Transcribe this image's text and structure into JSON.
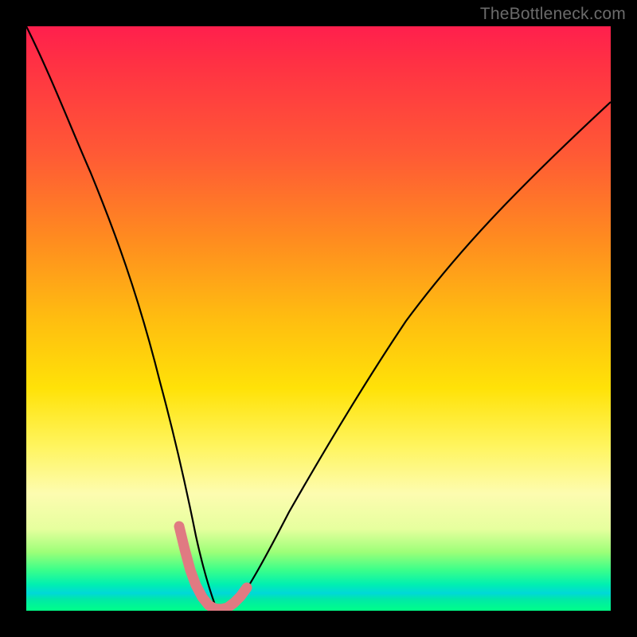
{
  "watermark": {
    "text": "TheBottleneck.com"
  },
  "colors": {
    "background": "#000000",
    "curve": "#000000",
    "marker_stroke": "#e07a82",
    "gradient_stops": [
      "#ff1f4d",
      "#ff5a35",
      "#ffbd10",
      "#fff560",
      "#9cff78",
      "#00d8d8",
      "#00ff88"
    ]
  },
  "chart_data": {
    "type": "line",
    "title": "",
    "xlabel": "",
    "ylabel": "",
    "xlim": [
      0,
      100
    ],
    "ylim": [
      0,
      100
    ],
    "series": [
      {
        "name": "bottleneck-curve",
        "x": [
          0,
          2,
          5,
          8,
          11,
          14,
          17,
          20,
          22,
          24,
          26,
          27.5,
          29,
          31,
          32.5,
          34,
          36,
          40,
          45,
          50,
          55,
          60,
          65,
          70,
          75,
          80,
          85,
          90,
          95,
          100
        ],
        "y": [
          100,
          93,
          84,
          75,
          66,
          57,
          48,
          39,
          30,
          22,
          14,
          8,
          4,
          1,
          0,
          0.5,
          2,
          7,
          14,
          22,
          30,
          38,
          46,
          54,
          61,
          67,
          73,
          78,
          83,
          87
        ]
      }
    ],
    "markers": {
      "name": "highlighted-range",
      "x": [
        26,
        27,
        28,
        29,
        30,
        31,
        32,
        33,
        34,
        35,
        36,
        37
      ],
      "y": [
        14,
        10,
        6,
        4,
        2,
        1,
        0.3,
        0.2,
        0.5,
        1.2,
        2,
        3.5
      ]
    },
    "min_point": {
      "x": 32.5,
      "y": 0
    }
  }
}
